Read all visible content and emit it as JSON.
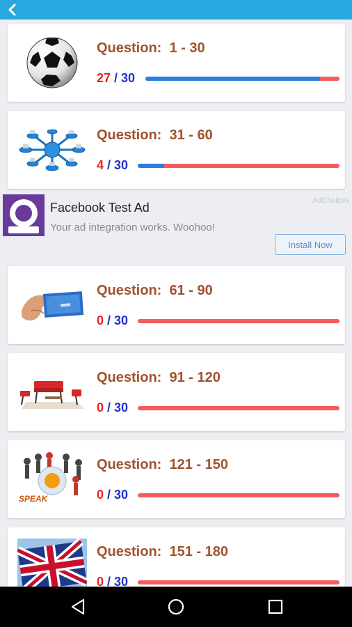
{
  "topbar": {
    "back_icon": "chevron-left-icon",
    "color": "#29a8e0"
  },
  "quizzes": [
    {
      "title": "Question:  1 - 30",
      "done": "27",
      "sep": " / ",
      "total": "30",
      "progress": 0.9,
      "thumb_icon": "soccer-ball-icon"
    },
    {
      "title": "Question:  31 - 60",
      "done": "4",
      "sep": " / ",
      "total": "30",
      "progress": 0.13,
      "thumb_icon": "network-icon"
    },
    {
      "title": "Question:  61 - 90",
      "done": "0",
      "sep": " / ",
      "total": "30",
      "progress": 0,
      "thumb_icon": "hand-card-icon"
    },
    {
      "title": "Question:  91 - 120",
      "done": "0",
      "sep": " / ",
      "total": "30",
      "progress": 0,
      "thumb_icon": "furniture-icon"
    },
    {
      "title": "Question:  121 - 150",
      "done": "0",
      "sep": " / ",
      "total": "30",
      "progress": 0,
      "thumb_icon": "speak-people-icon"
    },
    {
      "title": "Question:  151 - 180",
      "done": "0",
      "sep": " / ",
      "total": "30",
      "progress": 0,
      "thumb_icon": "uk-flag-icon"
    }
  ],
  "ad": {
    "title": "Facebook Test Ad",
    "body": "Your ad integration works. Woohoo!",
    "choices": "AdChoices",
    "install": "Install Now",
    "logo_icon": "ad-logo-icon"
  },
  "navbar": {
    "back": "nav-back-icon",
    "home": "nav-home-icon",
    "recents": "nav-recents-icon"
  },
  "colors": {
    "title": "#a0522d",
    "done": "#ef2222",
    "total": "#2233cc",
    "bar_bg": "#f25c5c",
    "bar_fill": "#2a7de1"
  }
}
